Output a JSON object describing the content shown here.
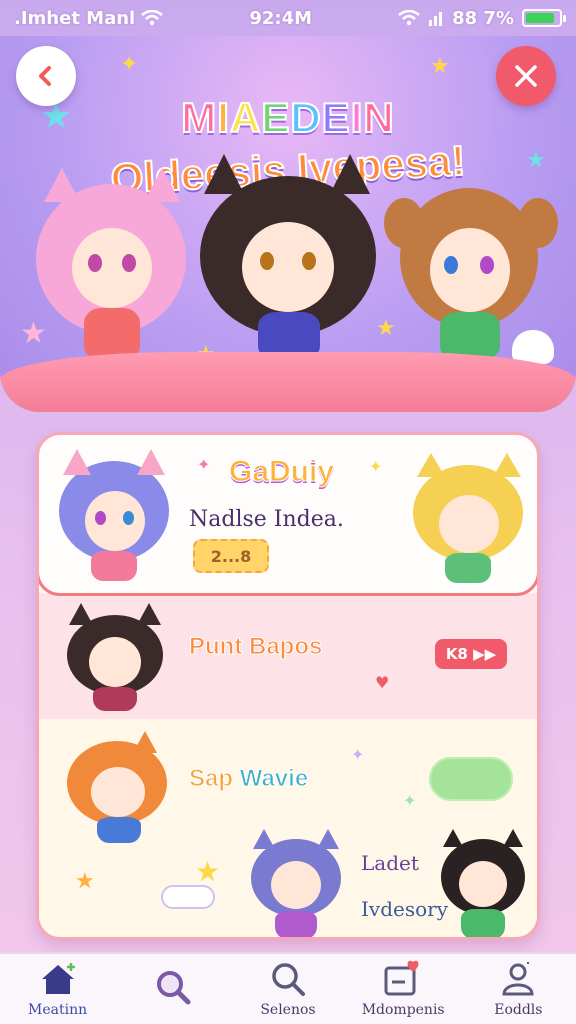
{
  "status_bar": {
    "carrier": ".Imhet Manl",
    "time": "92:4M",
    "battery_text": "88 7%",
    "battery_level": 0.87,
    "battery_color": "#3dd35a"
  },
  "header": {
    "back_icon": "chevron-left-icon",
    "close_icon": "close-icon",
    "title_line1": "MIAEDEIN",
    "title_line2": "Oldeesis Ivepesa!"
  },
  "cards": [
    {
      "title": "GaDuiy",
      "subtitle": "Nadlse Indea.",
      "badge": "2...8"
    },
    {
      "title": "Punt Bapos",
      "action_label": "K8 ▶▶"
    },
    {
      "title_part1": "Sap ",
      "title_part2": "Wavie",
      "label1": "Ladet",
      "label2": "Ivdesory"
    }
  ],
  "nav": {
    "items": [
      {
        "label": "Meatinn",
        "icon": "home-icon",
        "active": true
      },
      {
        "label": "",
        "icon": "search-icon",
        "active": false
      },
      {
        "label": "Selenos",
        "icon": "search-icon",
        "active": false
      },
      {
        "label": "Mdompenis",
        "icon": "inbox-heart-icon",
        "active": false
      },
      {
        "label": "Eoddls",
        "icon": "profile-icon",
        "active": false
      }
    ]
  },
  "colors": {
    "accent_red": "#f05a6a",
    "accent_orange": "#ff8c3b",
    "background_purple": "#c9a9ee"
  }
}
